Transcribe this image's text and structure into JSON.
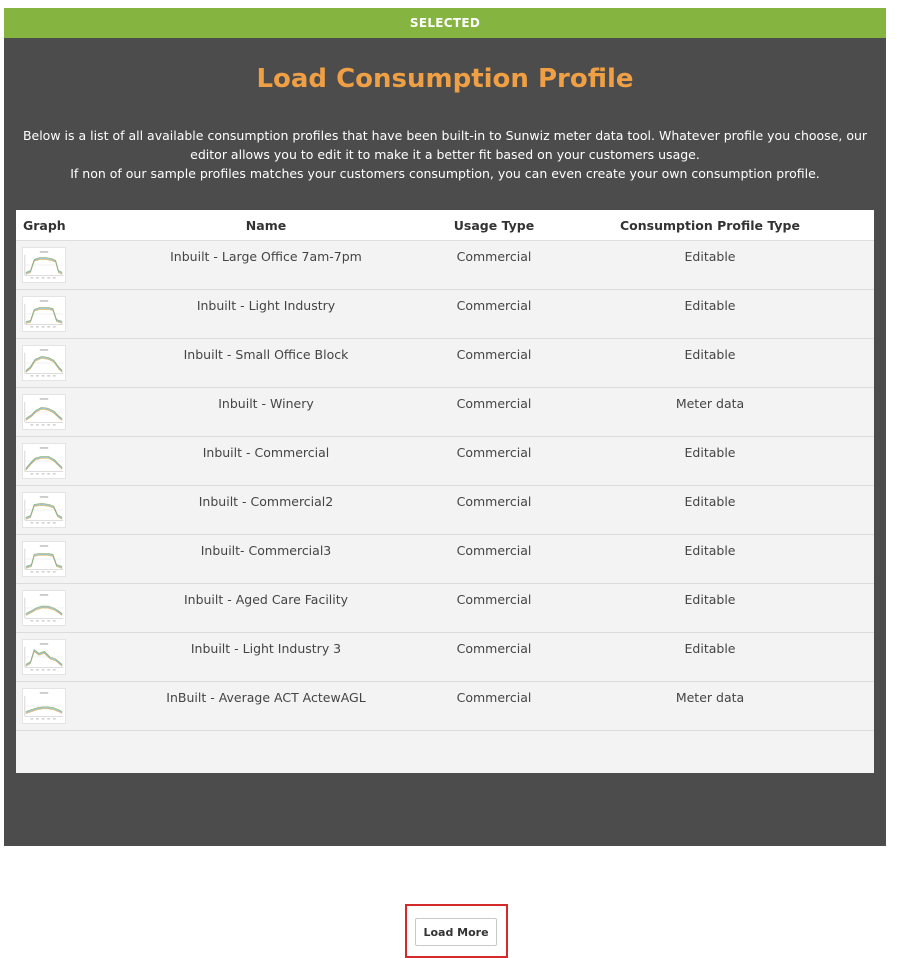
{
  "header": {
    "selected_label": "SELECTED"
  },
  "page": {
    "title": "Load Consumption Profile",
    "intro_lines": [
      "Below is a list of all available consumption profiles that have been built-in to Sunwiz meter data tool. Whatever profile you choose, our editor allows you to edit it to make it a better fit based on your customers usage.",
      "If non of our sample profiles matches your customers consumption, you can even create your own consumption profile."
    ]
  },
  "table": {
    "headers": {
      "graph": "Graph",
      "name": "Name",
      "usage": "Usage Type",
      "type": "Consumption Profile Type"
    },
    "rows": [
      {
        "name": "Inbuilt - Large Office 7am-7pm",
        "usage": "Commercial",
        "type": "Editable"
      },
      {
        "name": "Inbuilt - Light Industry",
        "usage": "Commercial",
        "type": "Editable"
      },
      {
        "name": "Inbuilt - Small Office Block",
        "usage": "Commercial",
        "type": "Editable"
      },
      {
        "name": "Inbuilt - Winery",
        "usage": "Commercial",
        "type": "Meter data"
      },
      {
        "name": "Inbuilt - Commercial",
        "usage": "Commercial",
        "type": "Editable"
      },
      {
        "name": "Inbuilt - Commercial2",
        "usage": "Commercial",
        "type": "Editable"
      },
      {
        "name": "Inbuilt- Commercial3",
        "usage": "Commercial",
        "type": "Editable"
      },
      {
        "name": "Inbuilt - Aged Care Facility",
        "usage": "Commercial",
        "type": "Editable"
      },
      {
        "name": "Inbuilt - Light Industry 3",
        "usage": "Commercial",
        "type": "Editable"
      },
      {
        "name": "InBuilt - Average ACT ActewAGL",
        "usage": "Commercial",
        "type": "Meter data"
      }
    ],
    "load_more_label": "Load More"
  },
  "colors": {
    "selected_bar": "#86b440",
    "panel": "#4c4c4c",
    "title": "#f0a044",
    "highlight": "#d42a2a"
  },
  "icons": {
    "row_graph": "consumption-graph-thumbnail"
  }
}
